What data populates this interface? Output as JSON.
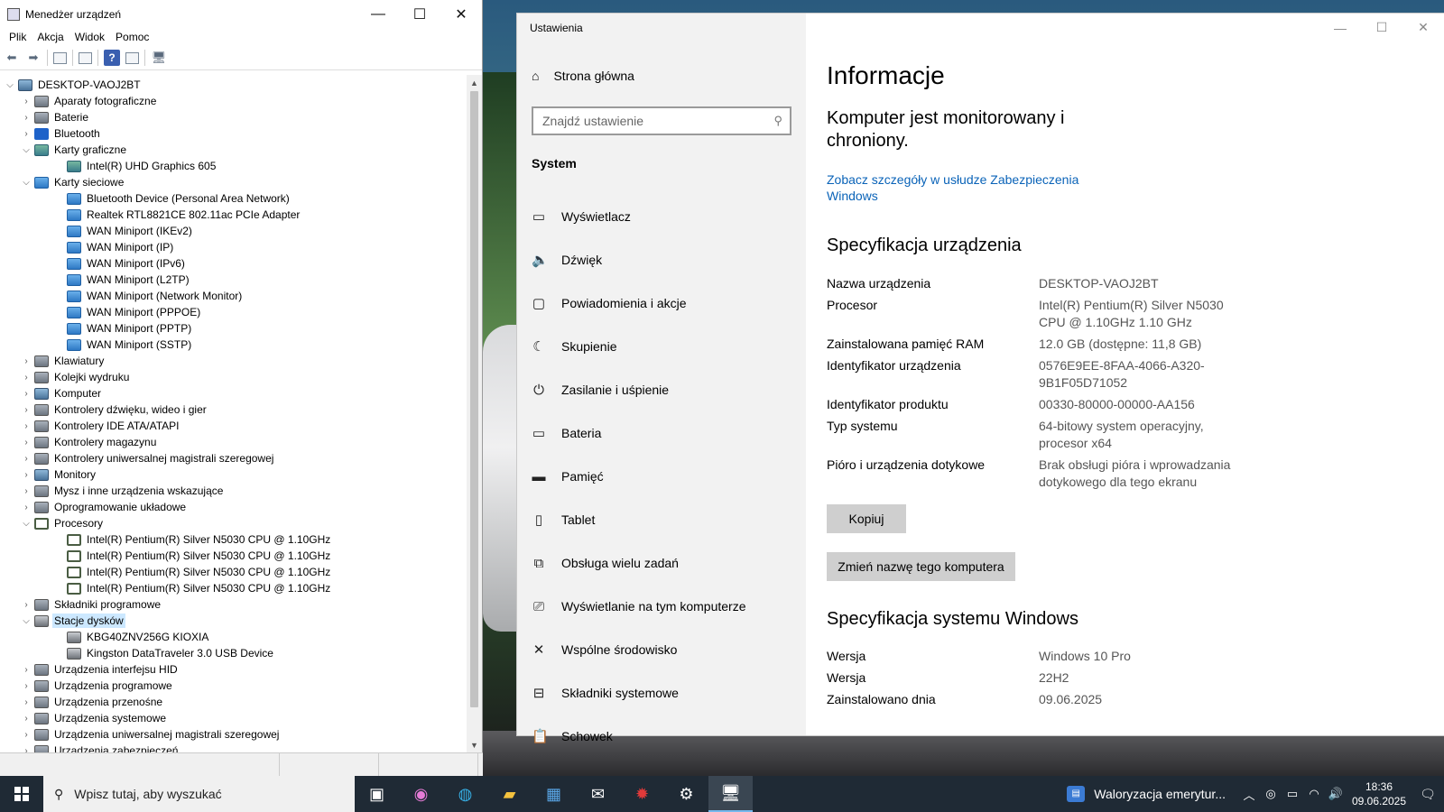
{
  "device_manager": {
    "title": "Menedżer urządzeń",
    "menu": [
      "Plik",
      "Akcja",
      "Widok",
      "Pomoc"
    ],
    "tree": [
      {
        "label": "DESKTOP-VAOJ2BT",
        "level": 0,
        "expanded": true,
        "icon": "computer-icon"
      },
      {
        "label": "Aparaty fotograficzne",
        "level": 1,
        "expanded": false,
        "icon": "camera-icon"
      },
      {
        "label": "Baterie",
        "level": 1,
        "expanded": false,
        "icon": "battery-icon"
      },
      {
        "label": "Bluetooth",
        "level": 1,
        "expanded": false,
        "icon": "bluetooth-icon"
      },
      {
        "label": "Karty graficzne",
        "level": 1,
        "expanded": true,
        "icon": "display-adapter-icon"
      },
      {
        "label": "Intel(R) UHD Graphics 605",
        "level": 2,
        "icon": "display-adapter-icon"
      },
      {
        "label": "Karty sieciowe",
        "level": 1,
        "expanded": true,
        "icon": "network-adapter-icon"
      },
      {
        "label": "Bluetooth Device (Personal Area Network)",
        "level": 2,
        "icon": "network-adapter-icon"
      },
      {
        "label": "Realtek RTL8821CE 802.11ac PCIe Adapter",
        "level": 2,
        "icon": "network-adapter-icon"
      },
      {
        "label": "WAN Miniport (IKEv2)",
        "level": 2,
        "icon": "network-adapter-icon"
      },
      {
        "label": "WAN Miniport (IP)",
        "level": 2,
        "icon": "network-adapter-icon"
      },
      {
        "label": "WAN Miniport (IPv6)",
        "level": 2,
        "icon": "network-adapter-icon"
      },
      {
        "label": "WAN Miniport (L2TP)",
        "level": 2,
        "icon": "network-adapter-icon"
      },
      {
        "label": "WAN Miniport (Network Monitor)",
        "level": 2,
        "icon": "network-adapter-icon"
      },
      {
        "label": "WAN Miniport (PPPOE)",
        "level": 2,
        "icon": "network-adapter-icon"
      },
      {
        "label": "WAN Miniport (PPTP)",
        "level": 2,
        "icon": "network-adapter-icon"
      },
      {
        "label": "WAN Miniport (SSTP)",
        "level": 2,
        "icon": "network-adapter-icon"
      },
      {
        "label": "Klawiatury",
        "level": 1,
        "expanded": false,
        "icon": "keyboard-icon"
      },
      {
        "label": "Kolejki wydruku",
        "level": 1,
        "expanded": false,
        "icon": "printer-icon"
      },
      {
        "label": "Komputer",
        "level": 1,
        "expanded": false,
        "icon": "computer-icon"
      },
      {
        "label": "Kontrolery dźwięku, wideo i gier",
        "level": 1,
        "expanded": false,
        "icon": "speaker-icon"
      },
      {
        "label": "Kontrolery IDE ATA/ATAPI",
        "level": 1,
        "expanded": false,
        "icon": "controller-icon"
      },
      {
        "label": "Kontrolery magazynu",
        "level": 1,
        "expanded": false,
        "icon": "storage-controller-icon"
      },
      {
        "label": "Kontrolery uniwersalnej magistrali szeregowej",
        "level": 1,
        "expanded": false,
        "icon": "usb-icon"
      },
      {
        "label": "Monitory",
        "level": 1,
        "expanded": false,
        "icon": "monitor-icon"
      },
      {
        "label": "Mysz i inne urządzenia wskazujące",
        "level": 1,
        "expanded": false,
        "icon": "mouse-icon"
      },
      {
        "label": "Oprogramowanie układowe",
        "level": 1,
        "expanded": false,
        "icon": "firmware-icon"
      },
      {
        "label": "Procesory",
        "level": 1,
        "expanded": true,
        "icon": "cpu-icon"
      },
      {
        "label": "Intel(R) Pentium(R) Silver N5030 CPU @ 1.10GHz",
        "level": 2,
        "icon": "cpu-icon"
      },
      {
        "label": "Intel(R) Pentium(R) Silver N5030 CPU @ 1.10GHz",
        "level": 2,
        "icon": "cpu-icon"
      },
      {
        "label": "Intel(R) Pentium(R) Silver N5030 CPU @ 1.10GHz",
        "level": 2,
        "icon": "cpu-icon"
      },
      {
        "label": "Intel(R) Pentium(R) Silver N5030 CPU @ 1.10GHz",
        "level": 2,
        "icon": "cpu-icon"
      },
      {
        "label": "Składniki programowe",
        "level": 1,
        "expanded": false,
        "icon": "software-component-icon"
      },
      {
        "label": "Stacje dysków",
        "level": 1,
        "expanded": true,
        "icon": "disk-drive-icon",
        "selected": true
      },
      {
        "label": "KBG40ZNV256G KIOXIA",
        "level": 2,
        "icon": "disk-drive-icon"
      },
      {
        "label": "Kingston DataTraveler 3.0 USB Device",
        "level": 2,
        "icon": "disk-drive-icon"
      },
      {
        "label": "Urządzenia interfejsu HID",
        "level": 1,
        "expanded": false,
        "icon": "hid-icon"
      },
      {
        "label": "Urządzenia programowe",
        "level": 1,
        "expanded": false,
        "icon": "software-device-icon"
      },
      {
        "label": "Urządzenia przenośne",
        "level": 1,
        "expanded": false,
        "icon": "portable-device-icon"
      },
      {
        "label": "Urządzenia systemowe",
        "level": 1,
        "expanded": false,
        "icon": "system-device-icon"
      },
      {
        "label": "Urządzenia uniwersalnej magistrali szeregowej",
        "level": 1,
        "expanded": false,
        "icon": "usb-icon"
      },
      {
        "label": "Urządzenia zabezpieczeń",
        "level": 1,
        "expanded": false,
        "icon": "security-device-icon"
      }
    ]
  },
  "settings": {
    "title": "Ustawienia",
    "home": "Strona główna",
    "search_placeholder": "Znajdź ustawienie",
    "section": "System",
    "nav": [
      {
        "label": "Wyświetlacz",
        "icon": "display-icon"
      },
      {
        "label": "Dźwięk",
        "icon": "sound-icon"
      },
      {
        "label": "Powiadomienia i akcje",
        "icon": "notifications-icon"
      },
      {
        "label": "Skupienie",
        "icon": "moon-icon"
      },
      {
        "label": "Zasilanie i uśpienie",
        "icon": "power-icon"
      },
      {
        "label": "Bateria",
        "icon": "battery-icon"
      },
      {
        "label": "Pamięć",
        "icon": "storage-icon"
      },
      {
        "label": "Tablet",
        "icon": "tablet-icon"
      },
      {
        "label": "Obsługa wielu zadań",
        "icon": "multitasking-icon"
      },
      {
        "label": "Wyświetlanie na tym komputerze",
        "icon": "projecting-icon"
      },
      {
        "label": "Wspólne środowisko",
        "icon": "shared-experiences-icon"
      },
      {
        "label": "Składniki systemowe",
        "icon": "system-components-icon"
      },
      {
        "label": "Schowek",
        "icon": "clipboard-icon"
      }
    ],
    "main": {
      "heading": "Informacje",
      "protection": "Komputer jest monitorowany i chroniony.",
      "security_link": "Zobacz szczegóły w usłudze Zabezpieczenia Windows",
      "device_spec_heading": "Specyfikacja urządzenia",
      "device_spec": [
        {
          "k": "Nazwa urządzenia",
          "v": "DESKTOP-VAOJ2BT"
        },
        {
          "k": "Procesor",
          "v": "Intel(R) Pentium(R) Silver N5030 CPU @ 1.10GHz   1.10 GHz"
        },
        {
          "k": "Zainstalowana pamięć RAM",
          "v": "12.0 GB (dostępne: 11,8 GB)"
        },
        {
          "k": "Identyfikator urządzenia",
          "v": "0576E9EE-8FAA-4066-A320-9B1F05D71052"
        },
        {
          "k": "Identyfikator produktu",
          "v": "00330-80000-00000-AA156"
        },
        {
          "k": "Typ systemu",
          "v": "64-bitowy system operacyjny, procesor x64"
        },
        {
          "k": "Pióro i urządzenia dotykowe",
          "v": "Brak obsługi pióra i wprowadzania dotykowego dla tego ekranu"
        }
      ],
      "copy_button": "Kopiuj",
      "rename_button": "Zmień nazwę tego komputera",
      "windows_spec_heading": "Specyfikacja systemu Windows",
      "windows_spec": [
        {
          "k": "Wersja",
          "v": "Windows 10 Pro"
        },
        {
          "k": "Wersja",
          "v": "22H2"
        },
        {
          "k": "Zainstalowano dnia",
          "v": "09.06.2025"
        }
      ]
    }
  },
  "taskbar": {
    "search_placeholder": "Wpisz tutaj, aby wyszukać",
    "news": "Waloryzacja emerytur...",
    "time": "18:36",
    "date": "09.06.2025"
  }
}
